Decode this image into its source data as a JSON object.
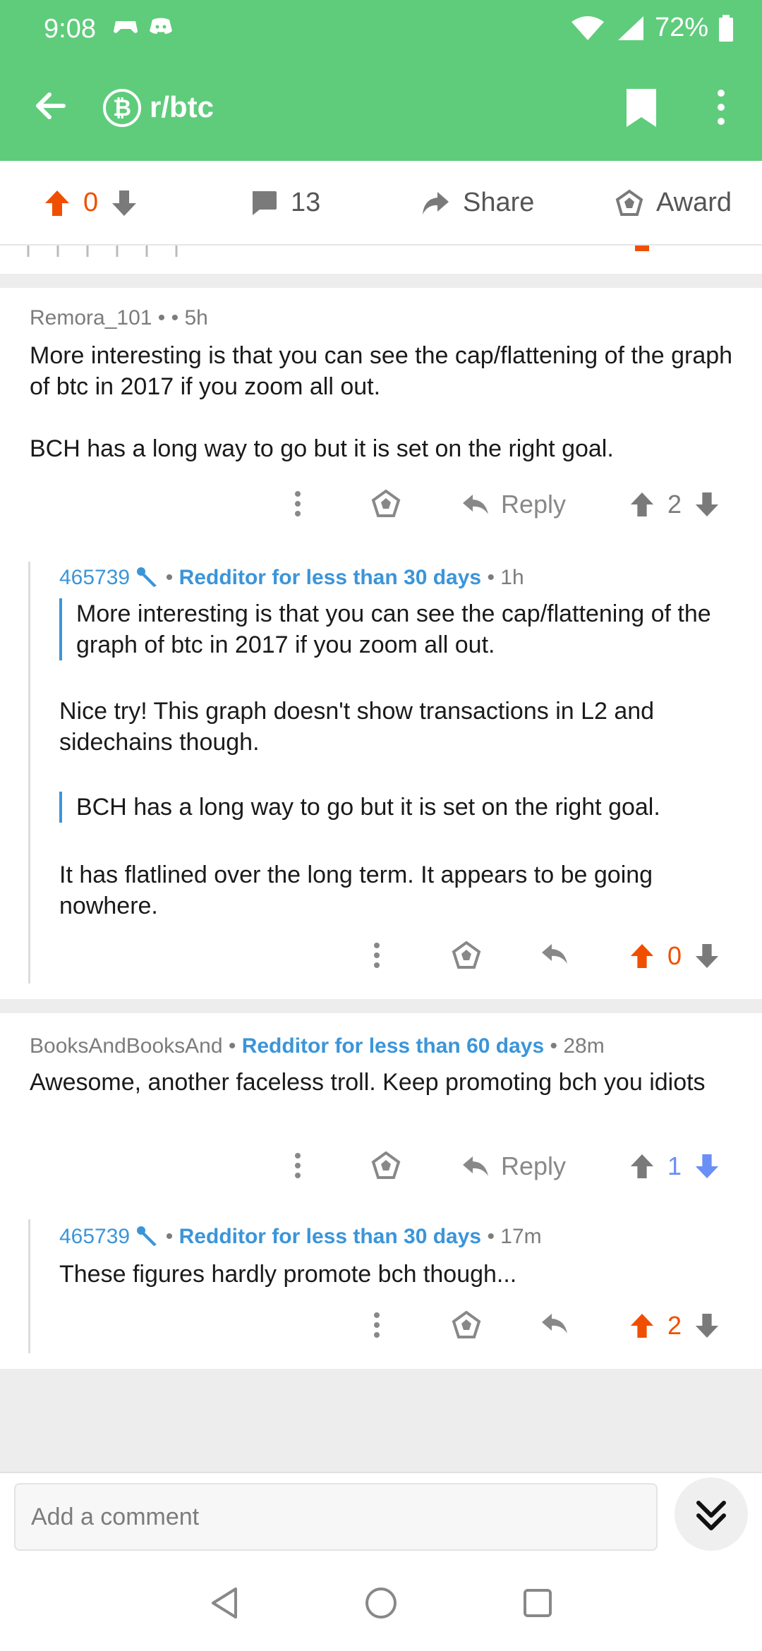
{
  "status_bar": {
    "time": "9:08",
    "battery": "72%"
  },
  "header": {
    "subreddit_icon": "₿",
    "subreddit": "r/btc"
  },
  "action_bar": {
    "score": "0",
    "comments": "13",
    "share": "Share",
    "award": "Award"
  },
  "comments": [
    {
      "author": "Remora_101",
      "meta_sep": " • ",
      "time": "• 5h",
      "paragraphs": [
        "More interesting  is that you can see the cap/flattening of the graph  of btc in 2017 if you zoom all out.",
        "BCH has a long way to go but it is set on the right goal."
      ],
      "reply_label": "Reply",
      "score": "2"
    },
    {
      "author": "465739",
      "flair": "Redditor for less than 30 days",
      "time": "• 1h",
      "quote1": "More interesting is that you can see the cap/flattening of the graph of btc in 2017 if you zoom all out.",
      "text1": "Nice try! This graph doesn't show transactions in L2 and sidechains though.",
      "quote2": "BCH has a long way to go but it is set on the right goal.",
      "text2": "It has flatlined over the long term.  It appears to be going nowhere.",
      "score": "0"
    },
    {
      "author": "BooksAndBooksAnd",
      "flair": "Redditor for less than 60 days",
      "time": "• 28m",
      "text": "Awesome, another faceless troll. Keep promoting bch you idiots",
      "reply_label": "Reply",
      "score": "1"
    },
    {
      "author": "465739",
      "flair": "Redditor for less than 30 days",
      "time": "• 17m",
      "text": "These figures hardly promote bch though...",
      "score": "2"
    }
  ],
  "composer": {
    "placeholder": "Add a comment"
  },
  "colors": {
    "header": "#5fcc7c",
    "upvote": "#f04f00",
    "downvote": "#6a8ff5",
    "flair": "#3b95d9"
  }
}
